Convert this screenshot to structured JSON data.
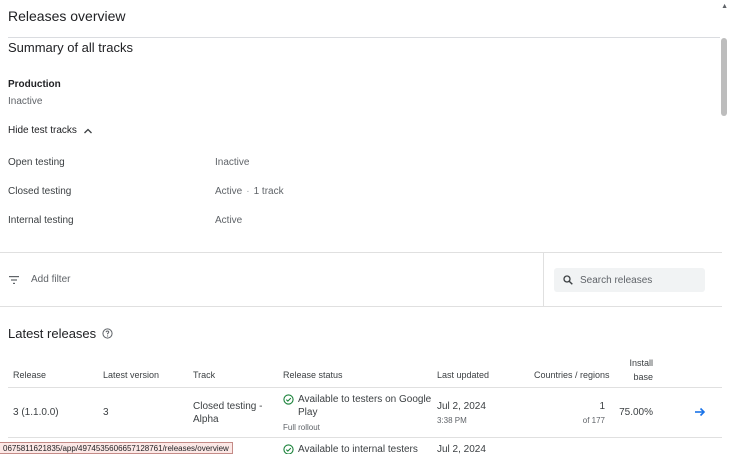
{
  "header": {
    "title": "Releases overview"
  },
  "summary": {
    "title": "Summary of all tracks",
    "production": {
      "label": "Production",
      "status": "Inactive"
    },
    "toggle_label": "Hide test tracks",
    "tracks": [
      {
        "name": "Open testing",
        "status": "Inactive",
        "extra": ""
      },
      {
        "name": "Closed testing",
        "status": "Active",
        "extra": "1 track"
      },
      {
        "name": "Internal testing",
        "status": "Active",
        "extra": ""
      }
    ]
  },
  "filter": {
    "add_filter_label": "Add filter",
    "search_placeholder": "Search releases"
  },
  "latest": {
    "title": "Latest releases",
    "columns": {
      "release": "Release",
      "latest_version": "Latest version",
      "track": "Track",
      "status": "Release status",
      "updated": "Last updated",
      "countries": "Countries / regions",
      "install_1": "Install",
      "install_2": "base"
    },
    "rows": [
      {
        "release": "3 (1.1.0.0)",
        "version": "3",
        "track_1": "Closed testing -",
        "track_2": "Alpha",
        "status_1": "Available to testers on Google",
        "status_2": "Play",
        "rollout": "Full rollout",
        "date": "Jul 2, 2024",
        "time": "3:38 PM",
        "countries": "1",
        "countries_total": "of 177",
        "install": "75.00%"
      },
      {
        "status_1": "Available to internal testers",
        "date": "Jul 2, 2024"
      }
    ]
  },
  "statusbar": {
    "url": "0675811621835/app/4974535606657128761/releases/overview"
  },
  "colors": {
    "accent": "#1a73e8",
    "success": "#188038"
  }
}
